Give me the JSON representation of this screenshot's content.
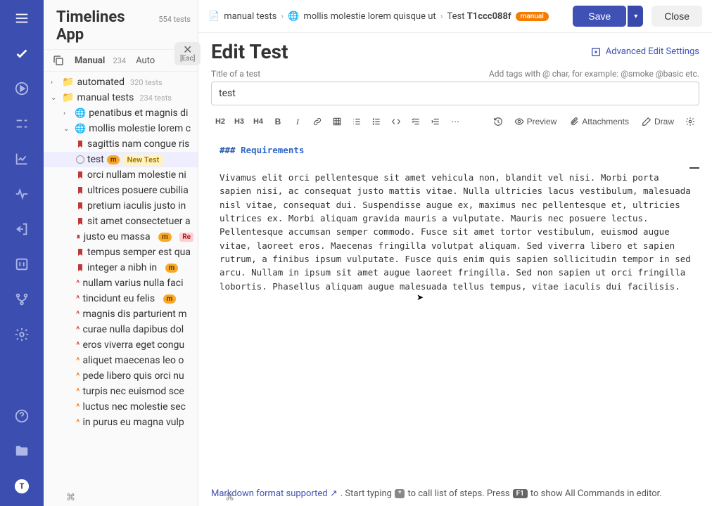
{
  "app": {
    "title": "Timelines App",
    "total": "554 tests"
  },
  "sidebarTabs": {
    "manual": {
      "label": "Manual",
      "count": "234"
    },
    "auto": {
      "label": "Auto"
    }
  },
  "closeEsc": {
    "x": "✕",
    "hint": "[Esc]"
  },
  "tree": {
    "automated": {
      "label": "automated",
      "count": "320 tests"
    },
    "manual": {
      "label": "manual tests",
      "count": "234 tests"
    },
    "sub1": "penatibus et magnis di",
    "sub2": "mollis molestie lorem c",
    "items": [
      "sagittis nam congue ris",
      "test",
      "orci nullam molestie ni",
      "ultrices posuere cubilia",
      "pretium iaculis justo in",
      "sit amet consectetuer a",
      "justo eu massa",
      "tempus semper est qua",
      "integer a nibh in",
      "nullam varius nulla faci",
      "tincidunt eu felis",
      "magnis dis parturient m",
      "curae nulla dapibus dol",
      "eros viverra eget congu",
      "aliquet maecenas leo o",
      "pede libero quis orci nu",
      "turpis nec euismod sce",
      "luctus nec molestie sec",
      "in purus eu magna vulp"
    ],
    "tagNew": "New Test",
    "tagM": "m",
    "tagRe": "Re"
  },
  "crumbs": {
    "root": "manual tests",
    "folder": "mollis molestie lorem quisque ut",
    "testPrefix": "Test ",
    "testId": "T1ccc088f",
    "badge": "manual"
  },
  "buttons": {
    "save": "Save",
    "close": "Close"
  },
  "page": {
    "title": "Edit Test",
    "advanced": "Advanced Edit Settings",
    "titleLabel": "Title of a test",
    "tagHint": "Add tags with @ char, for example: @smoke @basic etc.",
    "titleValue": "test"
  },
  "tb": {
    "h2": "H2",
    "h3": "H3",
    "h4": "H4",
    "bold": "B",
    "italic": "I",
    "more": "⋯",
    "preview": "Preview",
    "attachments": "Attachments",
    "draw": "Draw"
  },
  "editor": {
    "hash": "###",
    "heading": " Requirements",
    "body": "Vivamus elit orci pellentesque sit amet vehicula non, blandit vel nisi. Morbi porta sapien nisi, ac consequat justo mattis vitae. Nulla ultricies lacus vestibulum, malesuada nisl vitae, consequat dui. Suspendisse augue ex, maximus nec pellentesque et, ultricies ultrices ex. Morbi aliquam gravida mauris a vulputate. Mauris nec posuere lectus. Pellentesque accumsan semper commodo. Fusce sit amet tortor vestibulum, euismod augue vitae, laoreet eros. Maecenas fringilla volutpat aliquam. Sed viverra libero et sapien rutrum, a finibus ipsum vulputate. Fusce quis enim quis sapien sollicitudin tempor in sed arcu. Nullam in ipsum sit amet augue laoreet fringilla. Sed non sapien ut orci fringilla lobortis. Phasellus aliquam augue malesuada tellus tempus, vitae iaculis dui facilisis."
  },
  "footer": {
    "md": "Markdown format supported",
    "p1": ". Start typing ",
    "k1": "*",
    "p2": " to call list of steps. Press ",
    "k2": "F1",
    "p3": " to show All Commands in editor."
  },
  "kbcorner": "⌘"
}
